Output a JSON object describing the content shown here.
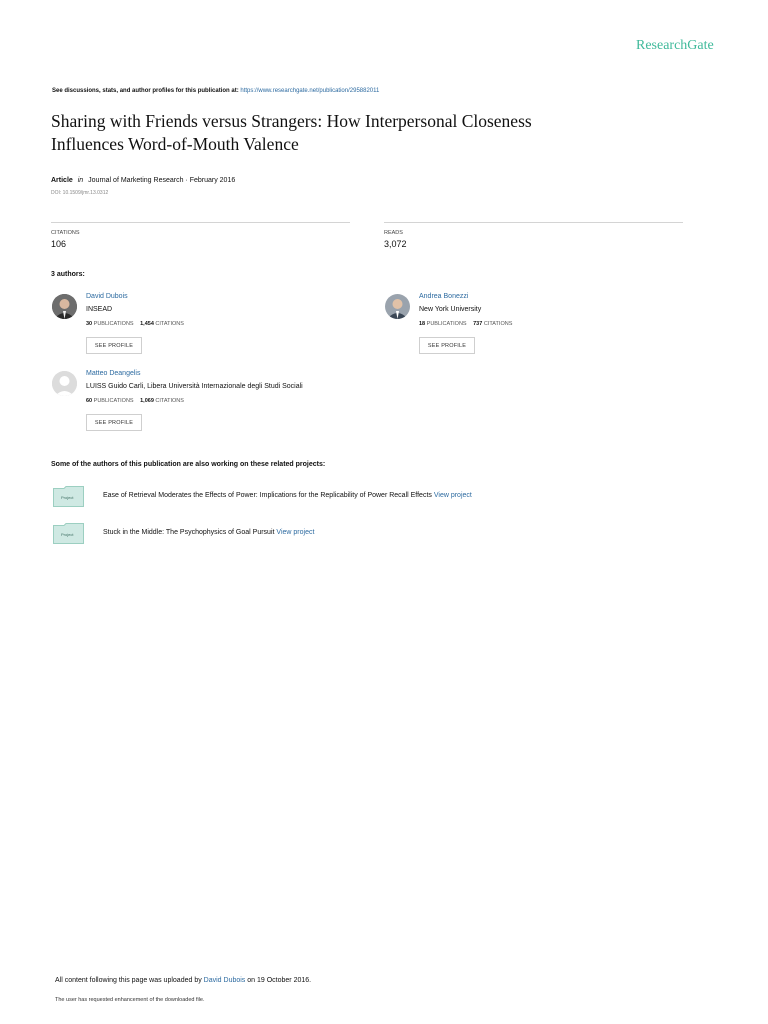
{
  "header": {
    "brand": "ResearchGate",
    "discussion_prefix": "See discussions, stats, and author profiles for this publication at:",
    "discussion_url": "https://www.researchgate.net/publication/295882011"
  },
  "article": {
    "title_line1": "Sharing with Friends versus Strangers: How Interpersonal Closeness",
    "title_line2": "Influences Word-of-Mouth Valence",
    "type": "Article",
    "in_word": "in",
    "journal": "Journal of Marketing Research · February 2016",
    "doi": "DOI: 10.1509/jmr.13.0312"
  },
  "stats": {
    "citations_label": "CITATIONS",
    "citations_value": "106",
    "reads_label": "READS",
    "reads_value": "3,072"
  },
  "authors_heading": "3 authors:",
  "authors": [
    {
      "name": "David Dubois",
      "affiliation": "INSEAD",
      "publications_count": "30",
      "publications_label": "PUBLICATIONS",
      "citations_count": "1,454",
      "citations_label": "CITATIONS",
      "button": "SEE PROFILE"
    },
    {
      "name": "Andrea Bonezzi",
      "affiliation": "New York University",
      "publications_count": "18",
      "publications_label": "PUBLICATIONS",
      "citations_count": "737",
      "citations_label": "CITATIONS",
      "button": "SEE PROFILE"
    },
    {
      "name": "Matteo Deangelis",
      "affiliation": "LUISS Guido Carli, Libera Università Internazionale degli Studi Sociali",
      "publications_count": "60",
      "publications_label": "PUBLICATIONS",
      "citations_count": "1,069",
      "citations_label": "CITATIONS",
      "button": "SEE PROFILE"
    }
  ],
  "projects_heading": "Some of the authors of this publication are also working on these related projects:",
  "projects": [
    {
      "icon_label": "Project",
      "text": "Ease of Retrieval Moderates the Effects of Power: Implications for the Replicability of Power Recall Effects",
      "link": "View project"
    },
    {
      "icon_label": "Project",
      "text": "Stuck in the Middle: The Psychophysics of Goal Pursuit",
      "link": "View project"
    }
  ],
  "footer": {
    "uploaded_prefix": "All content following this page was uploaded by",
    "uploader": "David Dubois",
    "uploaded_suffix": "on 19 October 2016.",
    "enhancement_note": "The user has requested enhancement of the downloaded file."
  },
  "colors": {
    "brand": "#40ba9b",
    "link": "#2c6aa0",
    "project_icon": "#cfe9e3"
  }
}
